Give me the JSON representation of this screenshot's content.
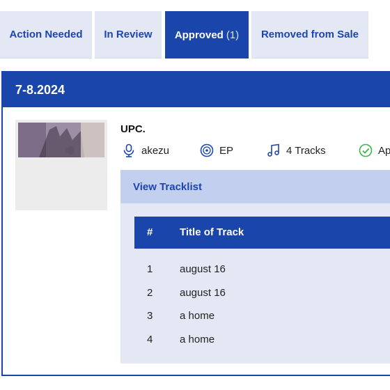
{
  "tabs": [
    {
      "label": "Action Needed",
      "count": ""
    },
    {
      "label": "In Review",
      "count": ""
    },
    {
      "label": "Approved",
      "count": "(1)"
    },
    {
      "label": "Removed from Sale",
      "count": ""
    }
  ],
  "release": {
    "date": "7-8.2024",
    "upc": "UPC.",
    "artist": "akezu",
    "type": "EP",
    "tracks_label": "4 Tracks",
    "status": "Ap"
  },
  "tracklist": {
    "toggle_label": "View Tracklist",
    "columns": [
      "#",
      "Title of Track"
    ],
    "rows": [
      {
        "num": "1",
        "title": "august 16"
      },
      {
        "num": "2",
        "title": "august 16"
      },
      {
        "num": "3",
        "title": "a home"
      },
      {
        "num": "4",
        "title": "a home"
      }
    ]
  },
  "colors": {
    "primary": "#1a45ab",
    "tab_bg": "#e4e8f4",
    "tracklist_bar": "#c3cfee",
    "status_green": "#3db34a"
  }
}
